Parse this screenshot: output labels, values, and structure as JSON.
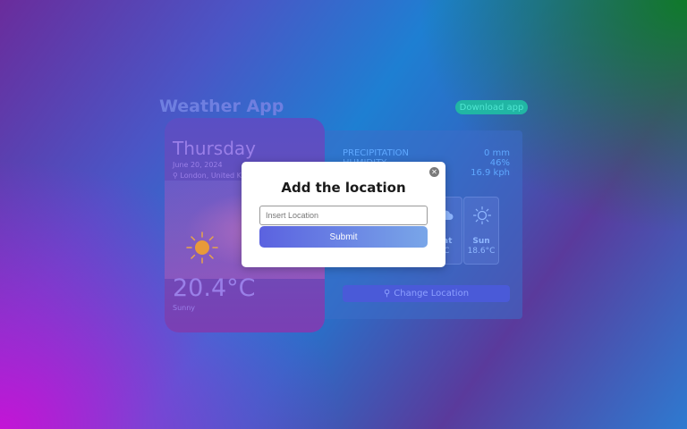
{
  "header": {
    "title": "Weather App",
    "download_label": "Download app"
  },
  "today": {
    "day": "Thursday",
    "date": "June 20, 2024",
    "location": "London, United Ki",
    "temperature": "20.4°C",
    "condition": "Sunny",
    "icon": "sun-icon"
  },
  "details": {
    "precipitation_label": "PRECIPITATION",
    "precipitation_value": "0 mm",
    "humidity_label": "HUMIDITY",
    "humidity_value": "46%",
    "wind_value": "16.9 kph"
  },
  "forecast": [
    {
      "day": "Sat",
      "temp": "°C",
      "icon": "cloud-icon"
    },
    {
      "day": "Sun",
      "temp": "18.6°C",
      "icon": "sun-icon"
    }
  ],
  "change_location_label": "Change Location",
  "modal": {
    "title": "Add the location",
    "input_placeholder": "Insert Location",
    "input_value": "",
    "submit_label": "Submit",
    "close_icon": "close-icon"
  },
  "colors": {
    "accent": "#5b62e0",
    "download_bg": "#21b6a4",
    "panel_text": "#5fa8ff"
  }
}
